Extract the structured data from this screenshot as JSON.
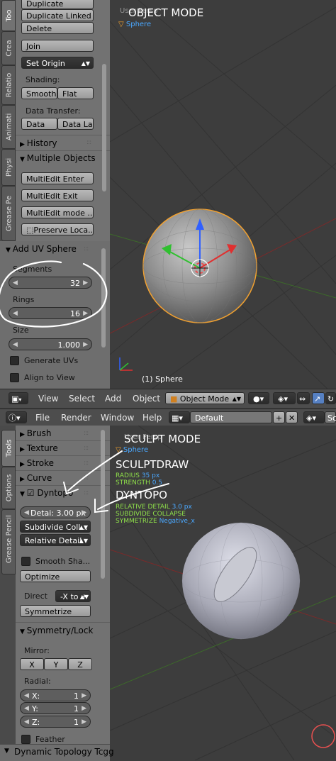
{
  "top": {
    "tabs": [
      "Too",
      "Crea",
      "Relatio",
      "Animati",
      "Physi",
      "Grease Pe"
    ],
    "panel": {
      "duplicate": "Duplicate",
      "duplicate_linked": "Duplicate Linked",
      "delete": "Delete",
      "join": "Join",
      "set_origin": "Set Origin",
      "shading_label": "Shading:",
      "smooth": "Smooth",
      "flat": "Flat",
      "data_transfer_label": "Data Transfer:",
      "data": "Data",
      "data_la": "Data La",
      "history": "History",
      "multiple_objects": "Multiple Objects",
      "multiedit_enter": "MultiEdit Enter",
      "multiedit_exit": "MultiEdit Exit",
      "multiedit_mode": "MultiEdit mode ...",
      "preserve_loca": "Preserve Loca..."
    },
    "operator": {
      "title": "Add UV Sphere",
      "segments_label": "Segments",
      "segments_value": "32",
      "rings_label": "Rings",
      "rings_value": "16",
      "size_label": "Size",
      "size_value": "1.000",
      "generate_uvs": "Generate UVs",
      "align_to_view": "Align to View"
    },
    "viewport": {
      "mode_text": "OBJECT MODE",
      "overlay_text": "User Persp",
      "object_name": "Sphere",
      "bottom_label": "(1) Sphere"
    },
    "header": {
      "view": "View",
      "select": "Select",
      "add": "Add",
      "object": "Object",
      "mode": "Object Mode"
    }
  },
  "bottom": {
    "menubar": {
      "file": "File",
      "render": "Render",
      "window": "Window",
      "help": "Help",
      "layout": "Default",
      "scene_trunc": "Sc"
    },
    "tabs": [
      "Tools",
      "Options",
      "Grease Pencil"
    ],
    "panel": {
      "brush": "Brush",
      "texture": "Texture",
      "stroke": "Stroke",
      "curve": "Curve",
      "dyntopo": "Dyntopo",
      "detail": "Detai: 3.00 px",
      "subdivide": "Subdivide Coll...",
      "relative_detail": "Relative Detail",
      "smooth_sha": "Smooth Sha...",
      "optimize": "Optimize",
      "direct_label": "Direct",
      "direct_value": "-X to +",
      "symmetrize": "Symmetrize",
      "symmetry_lock": "Symmetry/Lock",
      "mirror_label": "Mirror:",
      "x": "X",
      "y": "Y",
      "z": "Z",
      "radial_label": "Radial:",
      "rx": "X:",
      "ry": "Y:",
      "rz": "Z:",
      "rx_val": "1",
      "ry_val": "1",
      "rz_val": "1",
      "feather": "Feather",
      "footer": "Dynamic Topology Tcgg"
    },
    "viewport": {
      "mode_text": "SCULPT MODE",
      "overlay_text": "User Persp",
      "object_name": "Sphere",
      "brush_name": "SCULPTDRAW",
      "radius_label": "RADIUS",
      "radius_value": "35 px",
      "strength_label": "STRENGTH",
      "strength_value": "0.5",
      "dyntopo_title": "DYNTOPO",
      "relative_detail_label": "RELATIVE DETAIL",
      "relative_detail_value": "3.0 px",
      "subdivide_collapse": "SUBDIVIDE COLLAPSE",
      "symmetrize_label": "SYMMETRIZE",
      "symmetrize_value": "Negative_x"
    }
  },
  "colors": {
    "accent_green": "#8fe04a",
    "accent_blue": "#4aa8ff",
    "sphere_outline": "#f0a030",
    "annotation": "#ffffff",
    "cursor_red": "#e85050"
  }
}
